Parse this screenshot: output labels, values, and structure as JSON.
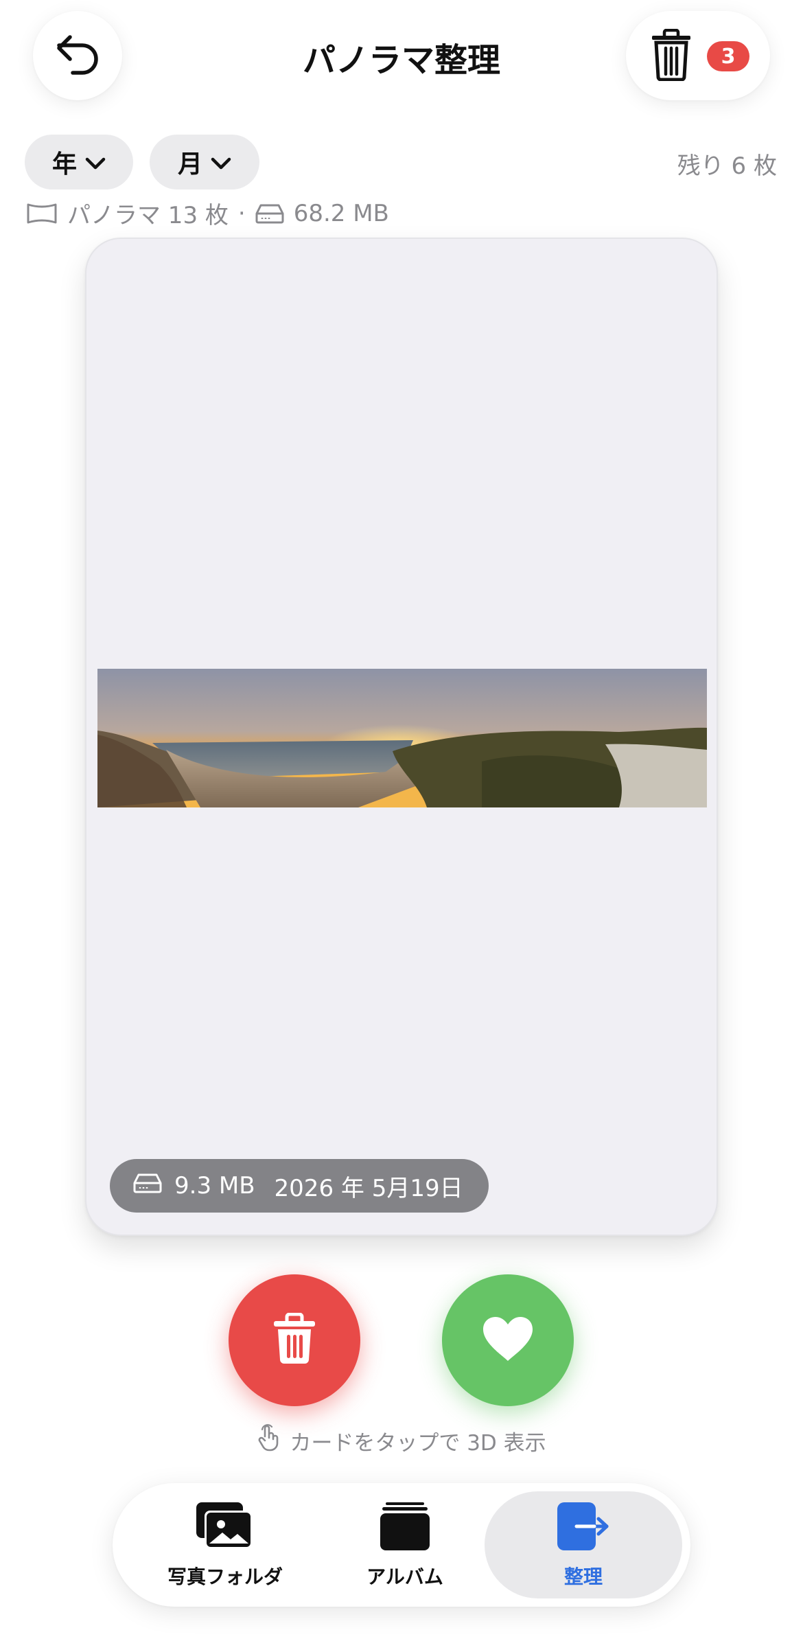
{
  "header": {
    "title": "パノラマ整理",
    "trash_count": "3"
  },
  "filters": {
    "year_label": "年",
    "month_label": "月",
    "remaining": "残り 6 枚"
  },
  "stats": {
    "count": "パノラマ 13 枚",
    "separator": "·",
    "size": "68.2 MB"
  },
  "card": {
    "size": "9.3 MB",
    "date": "2026 年 5月19日"
  },
  "hint": "カードをタップで 3D 表示",
  "tabs": [
    {
      "label": "写真フォルダ",
      "icon": "photos-stack-icon"
    },
    {
      "label": "アルバム",
      "icon": "album-stack-icon"
    },
    {
      "label": "整理",
      "icon": "organize-exit-icon"
    }
  ],
  "colors": {
    "accent": "#2f6fe0",
    "delete": "#e84a48",
    "keep": "#66c466",
    "badge": "#e84a46"
  }
}
